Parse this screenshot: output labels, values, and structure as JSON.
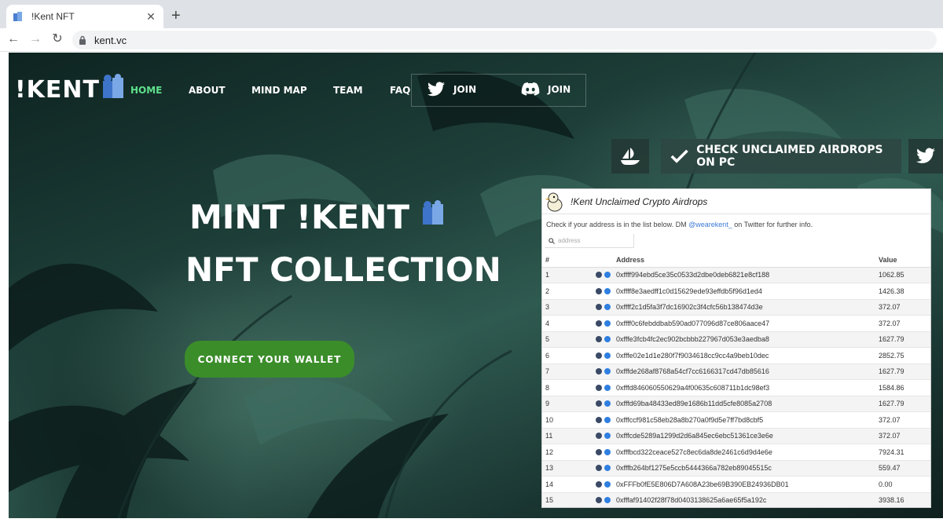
{
  "browser": {
    "tab_title": "!Kent NFT",
    "close_glyph": "✕",
    "newtab_glyph": "+",
    "url": "kent.vc",
    "back_glyph": "←",
    "forward_glyph": "→",
    "reload_glyph": "↻"
  },
  "site": {
    "logo_text": "!KENT",
    "nav": [
      {
        "label": "HOME",
        "active": true
      },
      {
        "label": "ABOUT"
      },
      {
        "label": "MIND MAP"
      },
      {
        "label": "TEAM"
      },
      {
        "label": "FAQ"
      }
    ],
    "join_twitter": "JOIN",
    "join_discord": "JOIN",
    "airdrop_button": "CHECK UNCLAIMED AIRDROPS ON PC",
    "hero_line1": "MINT !KENT",
    "hero_line2": "NFT COLLECTION",
    "connect_button": "CONNECT YOUR WALLET",
    "accent_color": "#5ee08a",
    "connect_color": "#3b8d2a"
  },
  "panel": {
    "title": "!Kent Unclaimed Crypto Airdrops",
    "info_before": "Check if your address is in the list below. DM ",
    "info_handle": "@wearekent_",
    "info_after": " on Twitter for further info.",
    "search_placeholder": "address",
    "columns": [
      "#",
      "Address",
      "Value"
    ],
    "rows": [
      {
        "n": "1",
        "address": "0xffff994ebd5ce35c0533d2dbe0deb6821e8cf188",
        "value": "1062.85"
      },
      {
        "n": "2",
        "address": "0xffff8e3aedff1c0d15629ede93effdb5f96d1ed4",
        "value": "1426.38"
      },
      {
        "n": "3",
        "address": "0xffff2c1d5fa3f7dc16902c3f4cfc56b138474d3e",
        "value": "372.07"
      },
      {
        "n": "4",
        "address": "0xffff0c6febddbab590ad077096d87ce806aace47",
        "value": "372.07"
      },
      {
        "n": "5",
        "address": "0xfffe3fcb4fc2ec902bcbbb227967d053e3aedba8",
        "value": "1627.79"
      },
      {
        "n": "6",
        "address": "0xfffe02e1d1e280f7f9034618cc9cc4a9beb10dec",
        "value": "2852.75"
      },
      {
        "n": "7",
        "address": "0xfffde268af8768a54cf7cc6166317cd47db85616",
        "value": "1627.79"
      },
      {
        "n": "8",
        "address": "0xfffd846060550629a4f00635c608711b1dc98ef3",
        "value": "1584.86"
      },
      {
        "n": "9",
        "address": "0xfffd69ba48433ed89e1686b11dd5cfe8085a2708",
        "value": "1627.79"
      },
      {
        "n": "10",
        "address": "0xfffccf981c58eb28a8b270a0f9d5e7ff7bd8cbf5",
        "value": "372.07"
      },
      {
        "n": "11",
        "address": "0xfffcde5289a1299d2d6a845ec6ebc51361ce3e6e",
        "value": "372.07"
      },
      {
        "n": "12",
        "address": "0xfffbcd322ceace527c8ec6da8de2461c6d9d4e6e",
        "value": "7924.31"
      },
      {
        "n": "13",
        "address": "0xfffb264bf1275e5ccb5444366a782eb89045515c",
        "value": "559.47"
      },
      {
        "n": "14",
        "address": "0xFFFb0fE5E806D7A608A23be69B390EB24936DB01",
        "value": "0.00"
      },
      {
        "n": "15",
        "address": "0xfffaf91402f28f78d0403138625a6ae65f5a192c",
        "value": "3938.16"
      }
    ]
  }
}
